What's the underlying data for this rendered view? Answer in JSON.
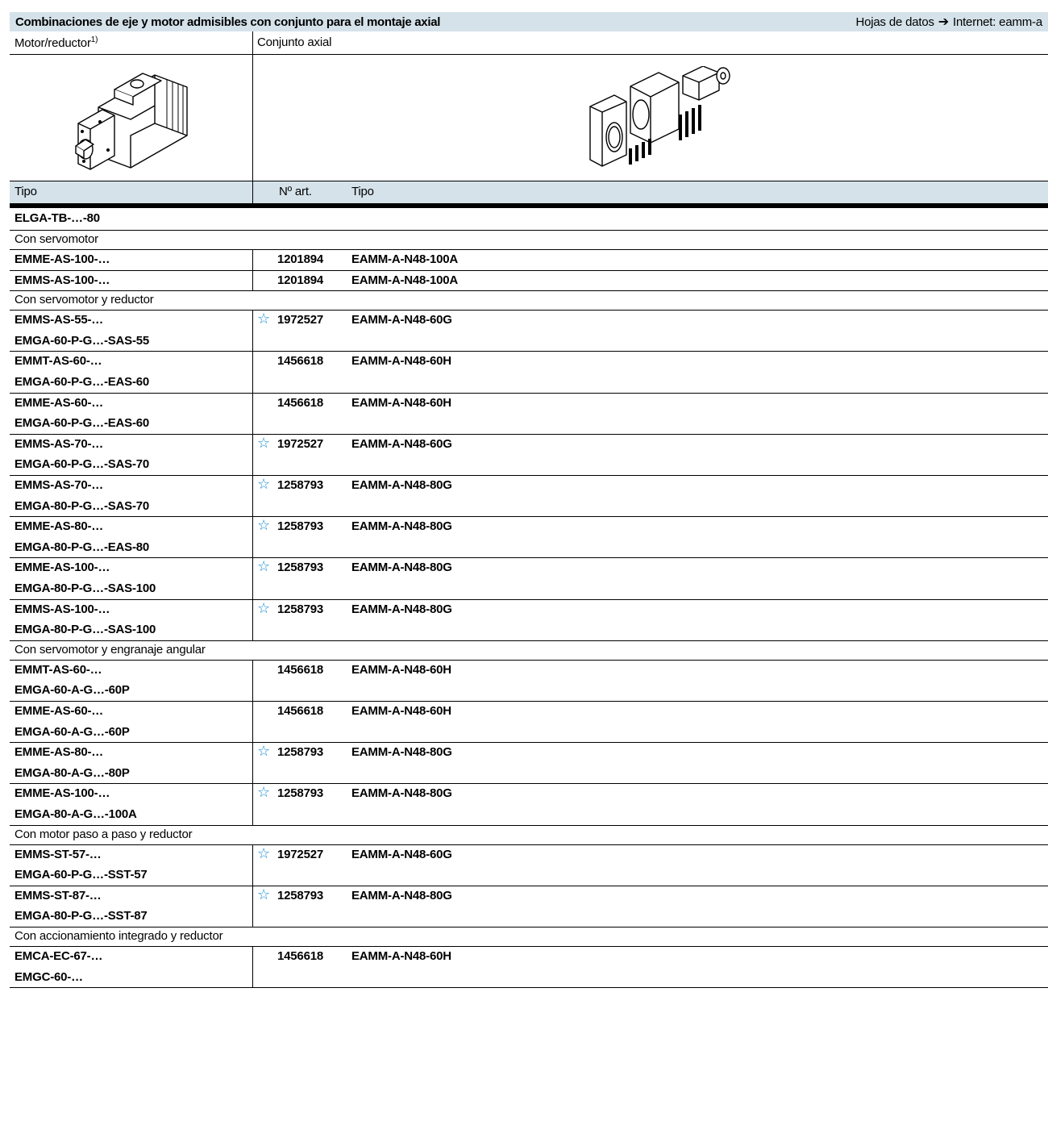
{
  "header": {
    "title": "Combinaciones de eje y motor admisibles con conjunto para el montaje axial",
    "ref_label": "Hojas de datos",
    "ref_arrow": "➔",
    "ref_target": "Internet: eamm-a"
  },
  "columns": {
    "motor": "Motor/reductor",
    "motor_sup": "1)",
    "kit": "Conjunto axial",
    "type": "Tipo",
    "part_no": "Nº art.",
    "kit_type": "Tipo"
  },
  "axis": "ELGA-TB-…-80",
  "sections": [
    {
      "label": "Con servomotor",
      "rows": [
        {
          "motor": [
            "EMME-AS-100-…"
          ],
          "star": false,
          "part": "1201894",
          "kit": "EAMM-A-N48-100A"
        },
        {
          "motor": [
            "EMMS-AS-100-…"
          ],
          "star": false,
          "part": "1201894",
          "kit": "EAMM-A-N48-100A"
        }
      ]
    },
    {
      "label": "Con servomotor y reductor",
      "rows": [
        {
          "motor": [
            "EMMS-AS-55-…",
            "EMGA-60-P-G…-SAS-55"
          ],
          "star": true,
          "part": "1972527",
          "kit": "EAMM-A-N48-60G"
        },
        {
          "motor": [
            "EMMT-AS-60-…",
            "EMGA-60-P-G…-EAS-60"
          ],
          "star": false,
          "part": "1456618",
          "kit": "EAMM-A-N48-60H"
        },
        {
          "motor": [
            "EMME-AS-60-…",
            "EMGA-60-P-G…-EAS-60"
          ],
          "star": false,
          "part": "1456618",
          "kit": "EAMM-A-N48-60H"
        },
        {
          "motor": [
            "EMMS-AS-70-…",
            "EMGA-60-P-G…-SAS-70"
          ],
          "star": true,
          "part": "1972527",
          "kit": "EAMM-A-N48-60G"
        },
        {
          "motor": [
            "EMMS-AS-70-…",
            "EMGA-80-P-G…-SAS-70"
          ],
          "star": true,
          "part": "1258793",
          "kit": "EAMM-A-N48-80G"
        },
        {
          "motor": [
            "EMME-AS-80-…",
            "EMGA-80-P-G…-EAS-80"
          ],
          "star": true,
          "part": "1258793",
          "kit": "EAMM-A-N48-80G"
        },
        {
          "motor": [
            "EMME-AS-100-…",
            "EMGA-80-P-G…-SAS-100"
          ],
          "star": true,
          "part": "1258793",
          "kit": "EAMM-A-N48-80G"
        },
        {
          "motor": [
            "EMMS-AS-100-…",
            "EMGA-80-P-G…-SAS-100"
          ],
          "star": true,
          "part": "1258793",
          "kit": "EAMM-A-N48-80G"
        }
      ]
    },
    {
      "label": "Con servomotor y engranaje angular",
      "rows": [
        {
          "motor": [
            "EMMT-AS-60-…",
            "EMGA-60-A-G…-60P"
          ],
          "star": false,
          "part": "1456618",
          "kit": "EAMM-A-N48-60H"
        },
        {
          "motor": [
            "EMME-AS-60-…",
            "EMGA-60-A-G…-60P"
          ],
          "star": false,
          "part": "1456618",
          "kit": "EAMM-A-N48-60H"
        },
        {
          "motor": [
            "EMME-AS-80-…",
            "EMGA-80-A-G…-80P"
          ],
          "star": true,
          "part": "1258793",
          "kit": "EAMM-A-N48-80G"
        },
        {
          "motor": [
            "EMME-AS-100-…",
            "EMGA-80-A-G…-100A"
          ],
          "star": true,
          "part": "1258793",
          "kit": "EAMM-A-N48-80G"
        }
      ]
    },
    {
      "label": "Con motor paso a paso y reductor",
      "rows": [
        {
          "motor": [
            "EMMS-ST-57-…",
            "EMGA-60-P-G…-SST-57"
          ],
          "star": true,
          "part": "1972527",
          "kit": "EAMM-A-N48-60G"
        },
        {
          "motor": [
            "EMMS-ST-87-…",
            "EMGA-80-P-G…-SST-87"
          ],
          "star": true,
          "part": "1258793",
          "kit": "EAMM-A-N48-80G"
        }
      ]
    },
    {
      "label": "Con accionamiento integrado y reductor",
      "rows": [
        {
          "motor": [
            "EMCA-EC-67-…",
            "EMGC-60-…"
          ],
          "star": false,
          "part": "1456618",
          "kit": "EAMM-A-N48-60H"
        }
      ]
    }
  ],
  "colors": {
    "header_bg": "#d5e2ea",
    "star": "#1a8bd4"
  }
}
